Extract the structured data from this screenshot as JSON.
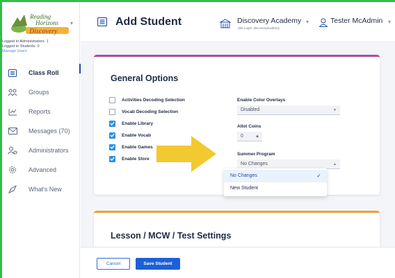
{
  "sidebar": {
    "logo_text_top": "Reading",
    "logo_text_mid": "Horizons",
    "logo_text_bottom": "Discovery",
    "session_admins": "Logged in Administrators: 1",
    "session_students": "Logged in Students: 0",
    "manage_users": "Manage Users",
    "items": [
      {
        "label": "Class Roll",
        "icon": "class-roll-icon",
        "active": true
      },
      {
        "label": "Groups",
        "icon": "groups-icon"
      },
      {
        "label": "Reports",
        "icon": "reports-icon"
      },
      {
        "label": "Messages (70)",
        "icon": "messages-icon"
      },
      {
        "label": "Administrators",
        "icon": "administrators-icon"
      },
      {
        "label": "Advanced",
        "icon": "gear-icon"
      },
      {
        "label": "What's New",
        "icon": "whats-new-icon"
      }
    ]
  },
  "header": {
    "title": "Add Student",
    "school_name": "Discovery Academy",
    "school_login": "Site Login: discoveryacademy",
    "user_name": "Tester McAdmin"
  },
  "general": {
    "title": "General Options",
    "checkboxes": [
      {
        "label": "Activities Decoding Selection",
        "checked": false
      },
      {
        "label": "Vocab Decoding Selection",
        "checked": false
      },
      {
        "label": "Enable Library",
        "checked": true
      },
      {
        "label": "Enable Vocab",
        "checked": true
      },
      {
        "label": "Enable Games",
        "checked": true
      },
      {
        "label": "Enable Store",
        "checked": true
      }
    ],
    "color_overlays_label": "Enable Color Overlays",
    "color_overlays_value": "Disabled",
    "allot_coins_label": "Allot Coins",
    "allot_coins_value": "0",
    "summer_label": "Summer Program",
    "summer_value": "No Changes",
    "summer_options": [
      "No Changes",
      "New Student"
    ],
    "summer_selected_index": 0
  },
  "lesson": {
    "title": "Lesson / MCW / Test Settings"
  },
  "footer": {
    "cancel": "Cancel",
    "save": "Save Student"
  },
  "colors": {
    "accent_green_frame": "#2fbf4a",
    "card1_border": "#b34a9e",
    "card2_border": "#f0a030",
    "primary_blue": "#1d5fd6",
    "arrow_yellow": "#f2c92e"
  }
}
